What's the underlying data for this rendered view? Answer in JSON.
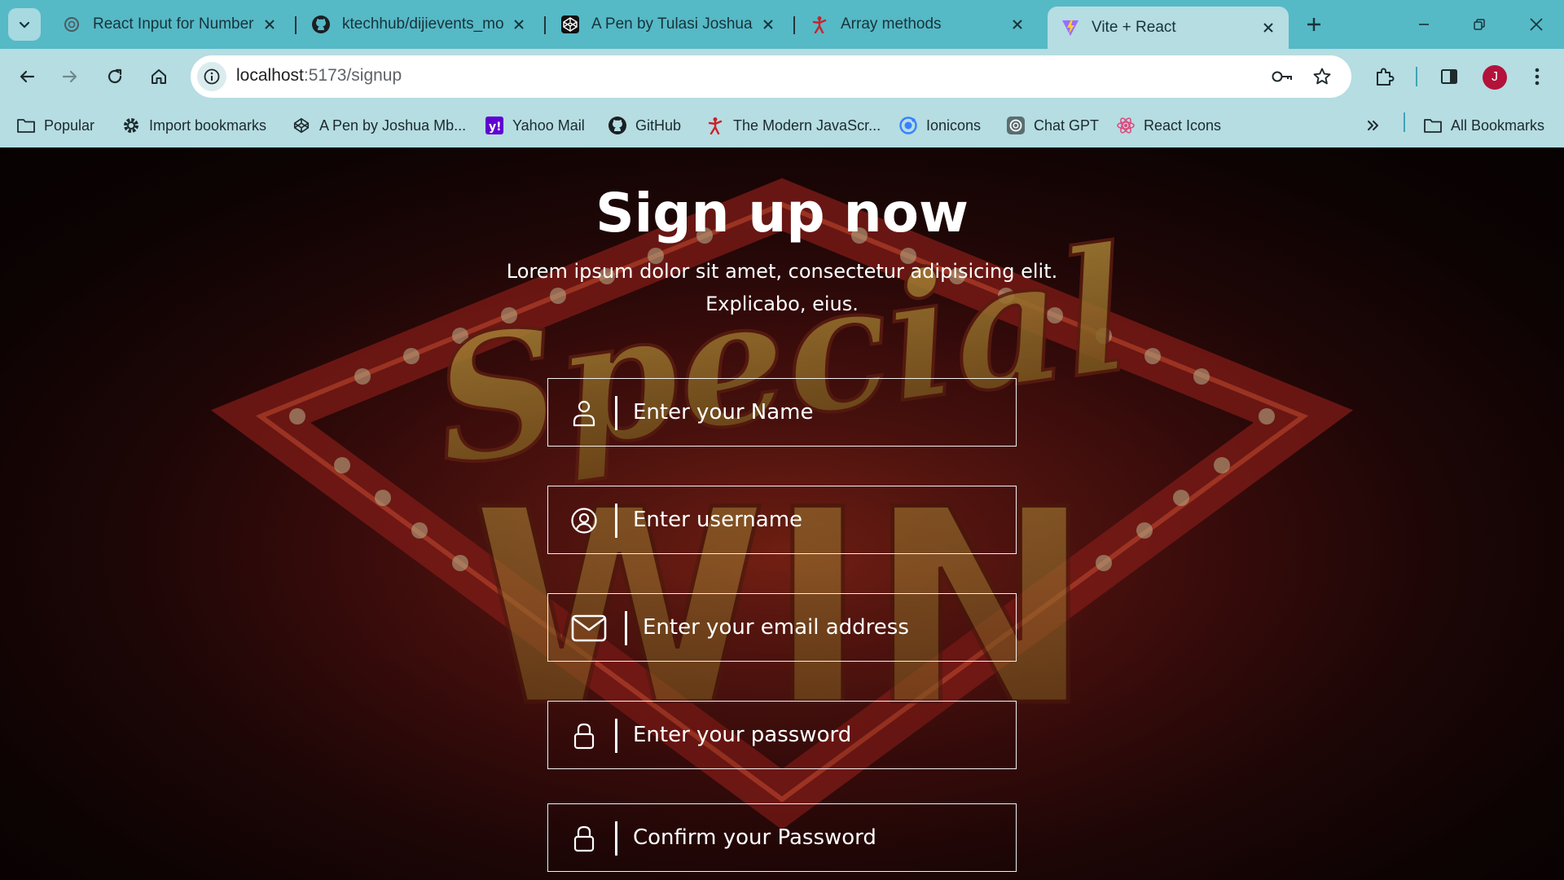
{
  "browser": {
    "tabs": [
      {
        "title": "React Input for Number",
        "icon": "chatgpt-icon",
        "active": false
      },
      {
        "title": "ktechhub/dijievents_mob",
        "icon": "github-icon",
        "active": false
      },
      {
        "title": "A Pen by Tulasi Joshua M",
        "icon": "codepen-icon",
        "active": false
      },
      {
        "title": "Array methods",
        "icon": "js-figure-icon",
        "active": false
      },
      {
        "title": "Vite + React",
        "icon": "vite-icon",
        "active": true
      }
    ],
    "url_host": "localhost",
    "url_path": ":5173/signup",
    "profile_initial": "J",
    "bookmarks": [
      {
        "label": "Popular",
        "icon": "folder-icon"
      },
      {
        "label": "Import bookmarks",
        "icon": "gear-icon"
      },
      {
        "label": "A Pen by Joshua Mb...",
        "icon": "codepen-icon"
      },
      {
        "label": "Yahoo Mail",
        "icon": "yahoo-icon"
      },
      {
        "label": "GitHub",
        "icon": "github-icon"
      },
      {
        "label": "The Modern JavaScr...",
        "icon": "js-figure-icon"
      },
      {
        "label": "Ionicons",
        "icon": "ionicons-icon"
      },
      {
        "label": "Chat GPT",
        "icon": "chatgpt-icon"
      },
      {
        "label": "React Icons",
        "icon": "react-icon"
      }
    ],
    "all_bookmarks_label": "All Bookmarks"
  },
  "page": {
    "title": "Sign up now",
    "subtitle_line1": "Lorem ipsum dolor sit amet, consectetur adipisicing elit.",
    "subtitle_line2": "Explicabo, eius.",
    "fields": [
      {
        "name": "name",
        "placeholder": "Enter your Name",
        "icon": "user-icon"
      },
      {
        "name": "username",
        "placeholder": "Enter username",
        "icon": "user-circle-icon"
      },
      {
        "name": "email",
        "placeholder": "Enter your email address",
        "icon": "envelope-icon"
      },
      {
        "name": "password",
        "placeholder": "Enter your password",
        "icon": "lock-icon"
      },
      {
        "name": "confirm_password",
        "placeholder": "Confirm your Password",
        "icon": "lock-icon"
      }
    ],
    "background_words": [
      "Special",
      "WIN"
    ]
  },
  "colors": {
    "tabstrip": "#56b9c6",
    "toolbar": "#b5dde2",
    "page_background": "#1d0606",
    "accent_gold": "#d6a625",
    "text_white": "#ffffff"
  }
}
